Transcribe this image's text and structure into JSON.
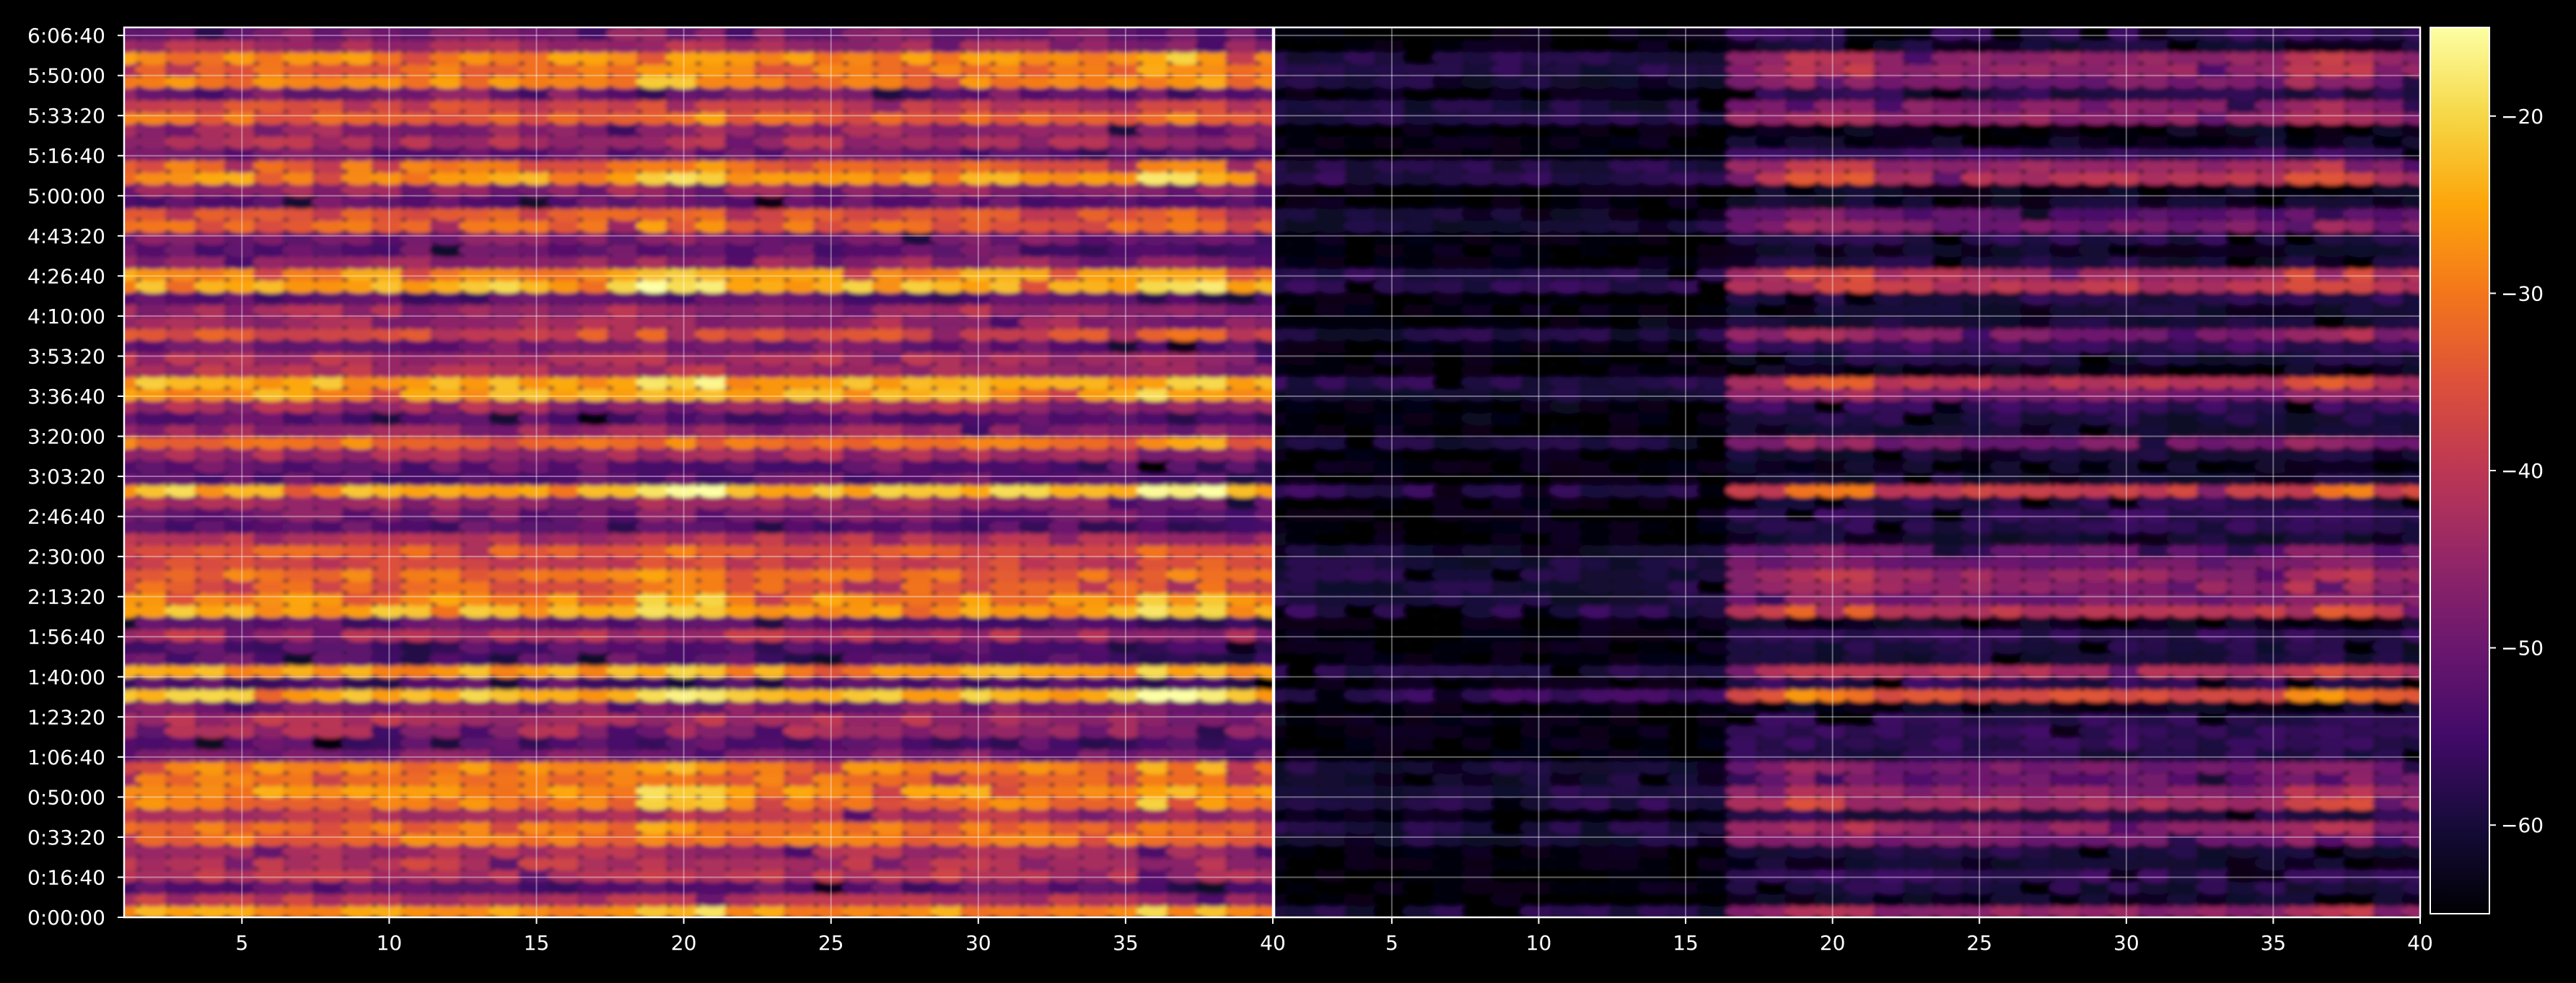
{
  "chart_data": {
    "type": "heatmap",
    "panels": [
      {
        "name": "",
        "x_ticks": [
          5,
          10,
          15,
          20,
          25,
          30,
          35,
          40
        ],
        "xlim": [
          1,
          40
        ]
      },
      {
        "name": "",
        "x_ticks": [
          5,
          10,
          15,
          20,
          25,
          30,
          35,
          40
        ],
        "xlim": [
          1,
          40
        ]
      }
    ],
    "x_tick_labels": [
      "5",
      "10",
      "15",
      "20",
      "25",
      "30",
      "35",
      "40"
    ],
    "y_tick_labels": [
      "0:00:00",
      "0:16:40",
      "0:33:20",
      "0:50:00",
      "1:06:40",
      "1:23:20",
      "1:40:00",
      "1:56:40",
      "2:13:20",
      "2:30:00",
      "2:46:40",
      "3:03:20",
      "3:20:00",
      "3:36:40",
      "3:53:20",
      "4:10:00",
      "4:26:40",
      "4:43:20",
      "5:00:00",
      "5:16:40",
      "5:33:20",
      "5:50:00",
      "6:06:40"
    ],
    "y_tick_seconds": [
      0,
      1000,
      2000,
      3000,
      4000,
      5000,
      6000,
      7000,
      8000,
      9000,
      10000,
      11000,
      12000,
      13000,
      14000,
      15000,
      16000,
      17000,
      18000,
      19000,
      20000,
      21000,
      22000
    ],
    "ylim_seconds": [
      0,
      22200
    ],
    "colorbar": {
      "colormap": "inferno",
      "range": [
        -65,
        -15
      ],
      "tick_labels": [
        "−20",
        "−30",
        "−40",
        "−50",
        "−60"
      ],
      "tick_values": [
        -20,
        -30,
        -40,
        -50,
        -60
      ]
    },
    "bright_rows_seconds": [
      0,
      2950,
      5500,
      7750,
      10650,
      13250,
      15900,
      18550,
      21300
    ],
    "mid_rows_seconds": [
      2150,
      3650,
      6200,
      8400,
      9000,
      11900,
      14600,
      17400,
      20100,
      20900
    ],
    "bright_columns": [
      20,
      37
    ],
    "grid": true,
    "colors": {
      "background": "#000000",
      "text": "#ffffff"
    }
  }
}
